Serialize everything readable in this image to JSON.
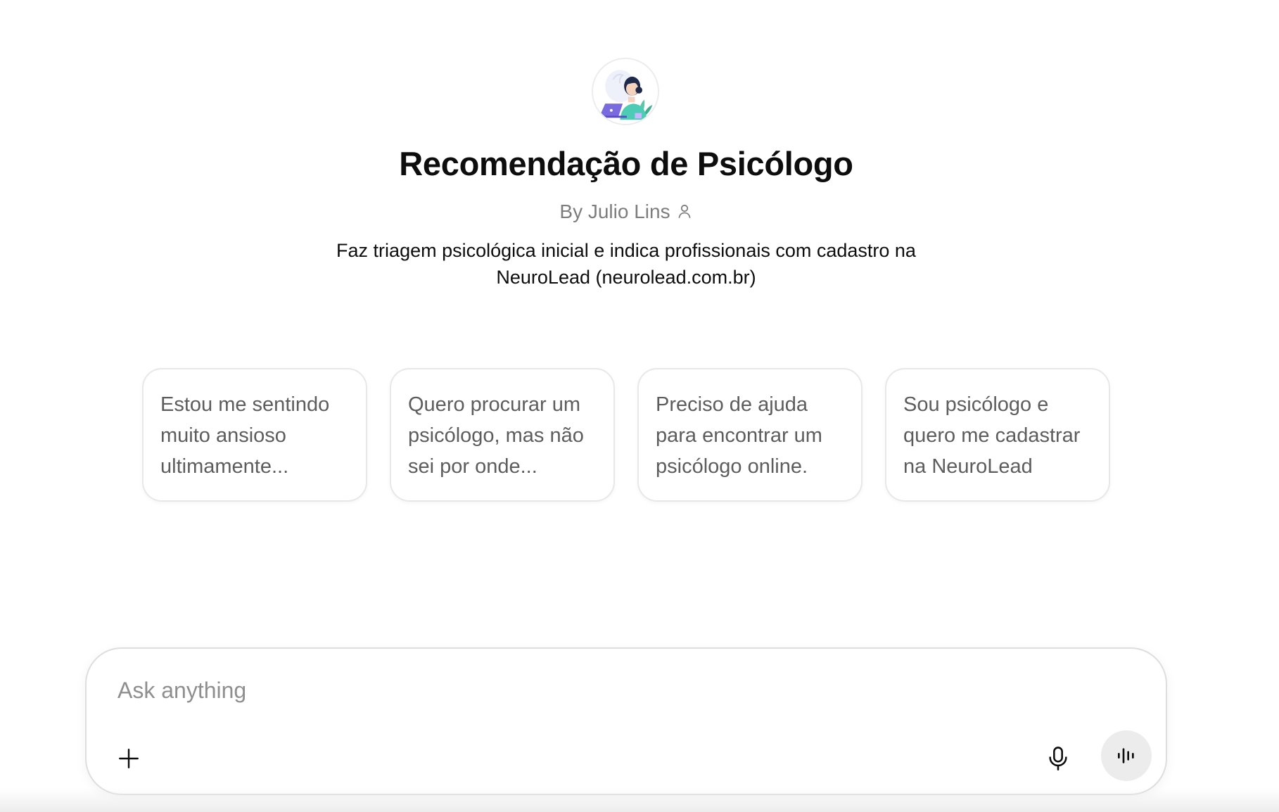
{
  "gpt": {
    "avatar_icon": "psychologist-illustration-icon",
    "title": "Recomendação de Psicólogo",
    "byline": "By Julio Lins",
    "byline_icon": "user-icon",
    "description": "Faz triagem psicológica inicial e indica profissionais com cadastro na NeuroLead (neurolead.com.br)"
  },
  "starters": [
    {
      "label": "Estou me sentindo muito ansioso ultimamente..."
    },
    {
      "label": "Quero procurar um psicólogo, mas não sei por onde..."
    },
    {
      "label": "Preciso de ajuda para encontrar um psicólogo online."
    },
    {
      "label": "Sou psicólogo e quero me cadastrar na NeuroLead"
    }
  ],
  "composer": {
    "placeholder": "Ask anything",
    "value": "",
    "attach_icon": "plus-icon",
    "dictate_icon": "microphone-icon",
    "voice_icon": "voice-waveform-icon"
  },
  "colors": {
    "title": "#0d0d0d",
    "muted_text": "#7d7d7d",
    "starter_text": "#5d5d5d",
    "border": "#e8e8e8",
    "voice_button_bg": "#ececec"
  }
}
